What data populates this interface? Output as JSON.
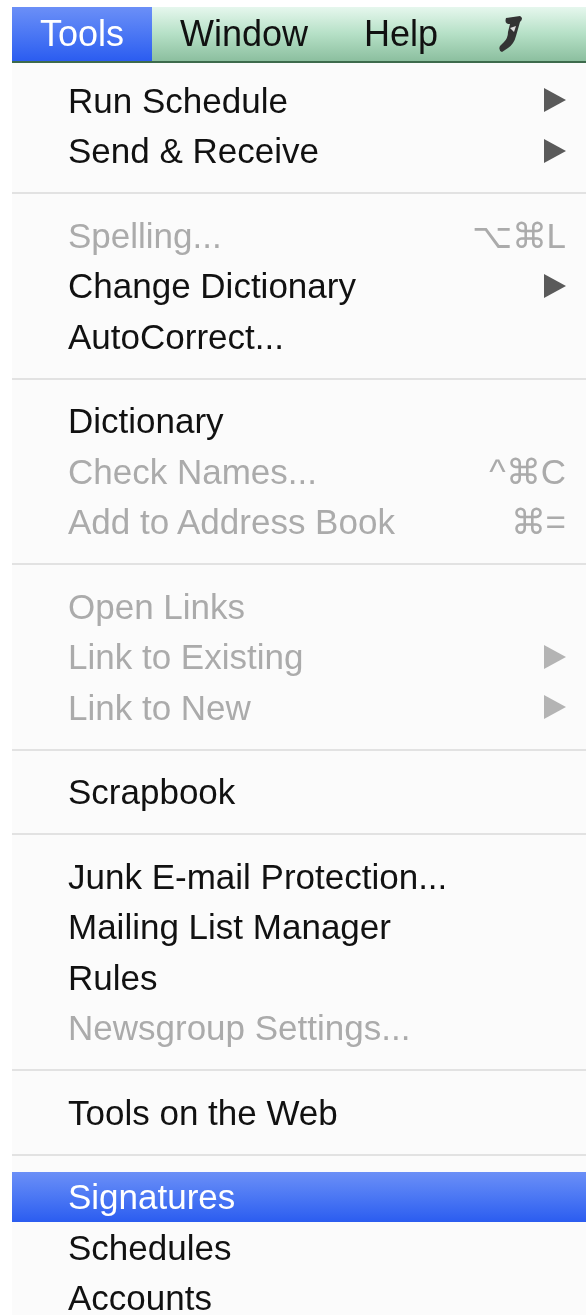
{
  "menubar": [
    {
      "label": "Tools",
      "selected": true
    },
    {
      "label": "Window",
      "selected": false
    },
    {
      "label": "Help",
      "selected": false
    }
  ],
  "menu": {
    "groups": [
      {
        "items": [
          {
            "label": "Run Schedule",
            "disabled": false,
            "submenu": true,
            "selected": false
          },
          {
            "label": "Send & Receive",
            "disabled": false,
            "submenu": true,
            "selected": false
          }
        ]
      },
      {
        "items": [
          {
            "label": "Spelling...",
            "disabled": true,
            "submenu": false,
            "shortcut": "⌥⌘L",
            "selected": false
          },
          {
            "label": "Change Dictionary",
            "disabled": false,
            "submenu": true,
            "selected": false
          },
          {
            "label": "AutoCorrect...",
            "disabled": false,
            "submenu": false,
            "selected": false
          }
        ]
      },
      {
        "items": [
          {
            "label": "Dictionary",
            "disabled": false,
            "submenu": false,
            "selected": false
          },
          {
            "label": "Check Names...",
            "disabled": true,
            "submenu": false,
            "shortcut": "^⌘C",
            "selected": false
          },
          {
            "label": "Add to Address Book",
            "disabled": true,
            "submenu": false,
            "shortcut": "⌘=",
            "selected": false
          }
        ]
      },
      {
        "items": [
          {
            "label": "Open Links",
            "disabled": true,
            "submenu": false,
            "selected": false
          },
          {
            "label": "Link to Existing",
            "disabled": true,
            "submenu": true,
            "selected": false
          },
          {
            "label": "Link to New",
            "disabled": true,
            "submenu": true,
            "selected": false
          }
        ]
      },
      {
        "items": [
          {
            "label": "Scrapbook",
            "disabled": false,
            "submenu": false,
            "selected": false
          }
        ]
      },
      {
        "items": [
          {
            "label": "Junk E-mail Protection...",
            "disabled": false,
            "submenu": false,
            "selected": false
          },
          {
            "label": "Mailing List Manager",
            "disabled": false,
            "submenu": false,
            "selected": false
          },
          {
            "label": "Rules",
            "disabled": false,
            "submenu": false,
            "selected": false
          },
          {
            "label": "Newsgroup Settings...",
            "disabled": true,
            "submenu": false,
            "selected": false
          }
        ]
      },
      {
        "items": [
          {
            "label": "Tools on the Web",
            "disabled": false,
            "submenu": false,
            "selected": false
          }
        ]
      },
      {
        "items": [
          {
            "label": "Signatures",
            "disabled": false,
            "submenu": false,
            "selected": true
          },
          {
            "label": "Schedules",
            "disabled": false,
            "submenu": false,
            "selected": false
          },
          {
            "label": "Accounts",
            "disabled": false,
            "submenu": false,
            "selected": false
          }
        ]
      }
    ]
  }
}
